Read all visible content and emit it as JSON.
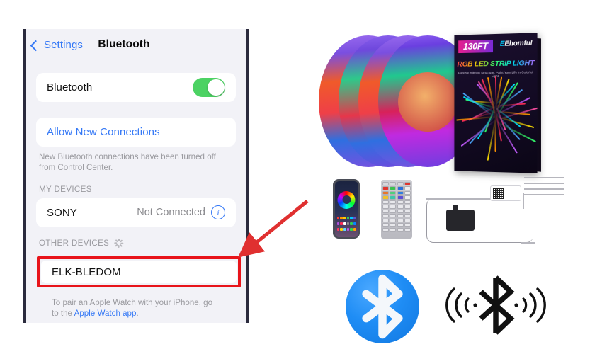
{
  "phone": {
    "nav": {
      "back_label": "Settings",
      "back_icon": "chevron-left-icon",
      "title": "Bluetooth"
    },
    "bluetooth_row": {
      "label": "Bluetooth",
      "toggle_state": "on",
      "toggle_color": "#4cd263"
    },
    "allow_new_connections": {
      "label": "Allow New Connections",
      "link_color": "#3478f6"
    },
    "allow_footnote": "New Bluetooth connections have been turned off from Control Center.",
    "my_devices": {
      "header": "MY DEVICES",
      "devices": [
        {
          "name": "SONY",
          "status": "Not Connected",
          "info_icon": "info-circle-icon"
        }
      ]
    },
    "other_devices": {
      "header": "OTHER DEVICES",
      "spinner_icon": "activity-spinner-icon",
      "devices": [
        {
          "name": "ELK-BLEDOM"
        }
      ],
      "highlight_color": "#e8141a"
    },
    "watch_footnote": {
      "text_before": "To pair an Apple Watch with your iPhone, go to the ",
      "link": "Apple Watch app",
      "text_after": "."
    }
  },
  "annotation": {
    "arrow": {
      "name": "red-arrow",
      "color": "#e03030",
      "points_to": "ELK-BLEDOM"
    }
  },
  "product": {
    "box": {
      "length_badge": "130FT",
      "brand": "Ehomful",
      "brand_initial": "E",
      "title": "RGB LED STRIP LIGHT",
      "subtitle": "Flexible Ribbon Structure, Paint Your Life in Colorful Light"
    },
    "reels": {
      "name": "led-strip-reels",
      "count": 4
    },
    "accessories": [
      {
        "name": "smartphone-app",
        "label": "phone-with-rgb-app"
      },
      {
        "name": "ir-remote",
        "label": "44-key-remote"
      },
      {
        "name": "power-adapter",
        "label": "power-adapter"
      },
      {
        "name": "controller-box",
        "label": "bluetooth-controller-qr"
      },
      {
        "name": "splitter-cable",
        "label": "4-way-splitter"
      }
    ]
  },
  "bluetooth_icons": [
    {
      "name": "bluetooth-logo-circle",
      "style": "blue-circle-white-rune",
      "color": "#1f8df5"
    },
    {
      "name": "bluetooth-signal-icon",
      "style": "black-rune-with-waves",
      "color": "#111111"
    }
  ]
}
